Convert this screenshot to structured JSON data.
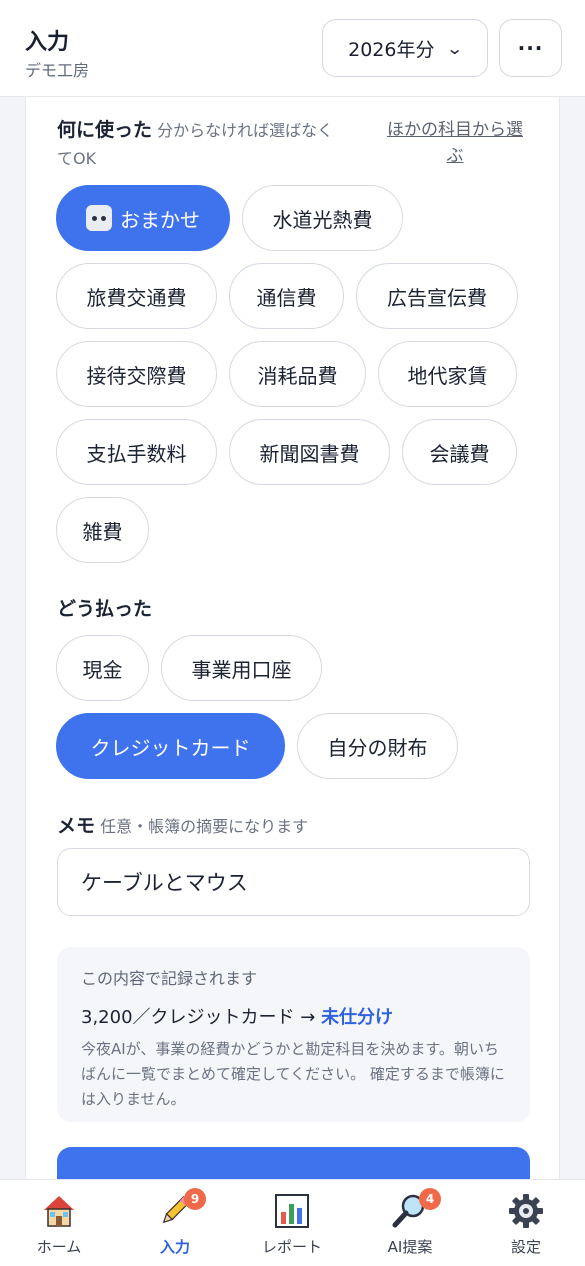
{
  "header": {
    "title": "入力",
    "subtitle": "デモ工房",
    "year_select": "2026年分",
    "more_label": "···"
  },
  "category": {
    "title": "何に使った",
    "hint_line1": "分からなければ選ばなく",
    "hint_line2": "てOK",
    "other_link_line1": "ほかの科目から選",
    "other_link_line2": "ぶ",
    "chips": [
      "おまかせ",
      "水道光熱費",
      "旅費交通費",
      "通信費",
      "広告宣伝費",
      "接待交際費",
      "消耗品費",
      "地代家賃",
      "支払手数料",
      "新聞図書費",
      "会議費",
      "雑費"
    ],
    "selected": "おまかせ"
  },
  "payment": {
    "title": "どう払った",
    "chips": [
      "現金",
      "事業用口座",
      "クレジットカード",
      "自分の財布"
    ],
    "selected": "クレジットカード"
  },
  "memo": {
    "title": "メモ",
    "hint": "任意・帳簿の摘要になります",
    "value": "ケーブルとマウス"
  },
  "summary": {
    "title": "この内容で記録されます",
    "main_prefix": "3,200／クレジットカード → ",
    "status": "未仕分け",
    "body": "今夜AIが、事業の経費かどうかと勘定科目を決めます。朝いちばんに一覧でまとめて確定してください。 確定するまで帳簿には入りません。"
  },
  "colors": {
    "accent": "#3f73ee",
    "badge": "#f06a4a"
  },
  "nav": [
    {
      "label": "ホーム",
      "icon": "house-icon"
    },
    {
      "label": "入力",
      "icon": "pencil-icon",
      "badge": "9",
      "active": true
    },
    {
      "label": "レポート",
      "icon": "bar-chart-icon"
    },
    {
      "label": "AI提案",
      "icon": "magnifier-icon",
      "badge": "4"
    },
    {
      "label": "設定",
      "icon": "gear-icon"
    }
  ]
}
